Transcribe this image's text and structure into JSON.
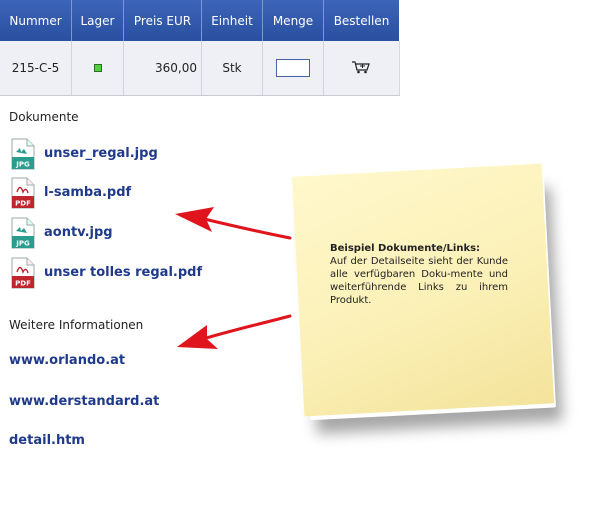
{
  "table": {
    "headers": [
      "Nummer",
      "Lager",
      "Preis EUR",
      "Einheit",
      "Menge",
      "Bestellen"
    ],
    "row": {
      "number": "215-C-5",
      "price": "360,00",
      "unit": "Stk",
      "quantity": "",
      "stock_color": "#4fd33a"
    }
  },
  "documents": {
    "heading": "Dokumente",
    "items": [
      {
        "name": "unser_regal.jpg",
        "type": "JPG",
        "color": "#2a9d8f"
      },
      {
        "name": "l-samba.pdf",
        "type": "PDF",
        "color": "#c0262d"
      },
      {
        "name": "aontv.jpg",
        "type": "JPG",
        "color": "#2a9d8f"
      },
      {
        "name": "unser tolles regal.pdf",
        "type": "PDF",
        "color": "#c0262d"
      }
    ]
  },
  "info": {
    "heading": "Weitere Informationen",
    "links": [
      "www.orlando.at",
      "www.derstandard.at",
      "detail.htm"
    ]
  },
  "note": {
    "title": "Beispiel Dokumente/Links:",
    "body": "Auf der Detailseite sieht der Kunde alle verfügbaren Doku-mente und weiterführende Links zu ihrem Produkt."
  },
  "colors": {
    "header_bg": "#2f56a8",
    "link": "#1f3a8a",
    "arrow": "#e0141c",
    "note": "#fbf0b7"
  }
}
